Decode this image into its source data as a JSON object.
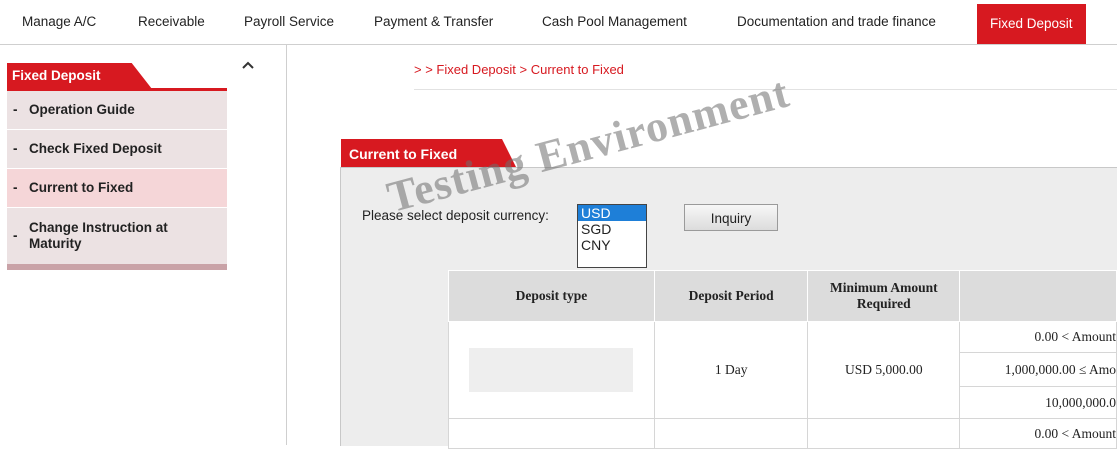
{
  "nav": {
    "items": [
      "Manage A/C",
      "Receivable",
      "Payroll Service",
      "Payment & Transfer",
      "Cash Pool Management",
      "Documentation and trade finance",
      "Fixed Deposit"
    ],
    "active": "Fixed Deposit"
  },
  "sidebar": {
    "title": "Fixed Deposit",
    "items": [
      {
        "label": "Operation Guide"
      },
      {
        "label": "Check Fixed Deposit"
      },
      {
        "label": "Current to Fixed"
      },
      {
        "label": "Change Instruction at Maturity"
      }
    ]
  },
  "breadcrumb": "> > Fixed Deposit > Current to Fixed",
  "panel": {
    "title": "Current to Fixed",
    "currency_label": "Please select deposit currency:",
    "currency_options": [
      "USD",
      "SGD",
      "CNY"
    ],
    "selected_currency": "USD",
    "inquiry_label": "Inquiry"
  },
  "table": {
    "headers": [
      "Deposit type",
      "Deposit Period",
      "Minimum Amount Required",
      ""
    ],
    "rows": [
      {
        "period": "1 Day",
        "minimum": "USD 5,000.00",
        "ranges": [
          "0.00 < Amount",
          "1,000,000.00 ≤ Amo",
          "10,000,000.0"
        ]
      },
      {
        "ranges": [
          "0.00 < Amount"
        ]
      }
    ]
  },
  "watermark": "Testing Environment",
  "colors": {
    "brand_red": "#d71920",
    "selection_blue": "#1e7fd8"
  },
  "icons": {
    "collapse": "chevron-up-icon"
  }
}
